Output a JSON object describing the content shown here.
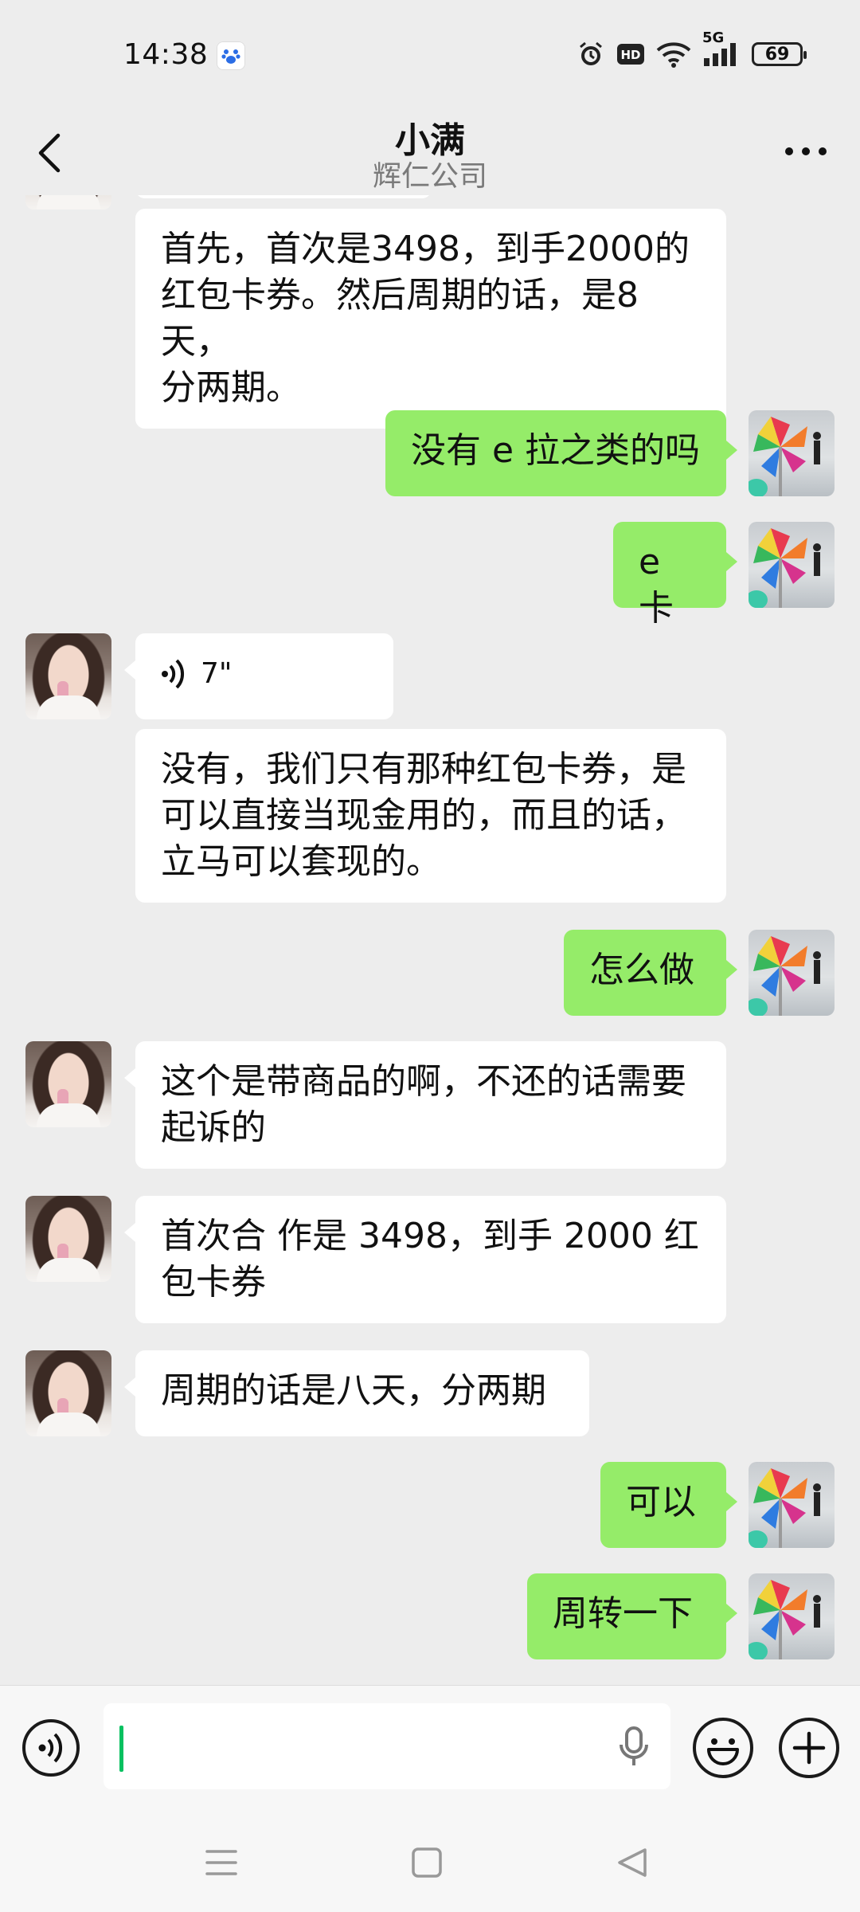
{
  "status_bar": {
    "time": "14:38",
    "battery": "69",
    "network": "5G",
    "icons": [
      "baidu-icon",
      "alarm-icon",
      "hd-icon",
      "wifi-icon",
      "signal-icon",
      "battery-icon"
    ]
  },
  "header": {
    "title": "小满",
    "subtitle": "辉仁公司"
  },
  "messages": [
    {
      "side": "left",
      "lines": [
        "首先，首次是3498，到手2000的",
        "红包卡券。然后周期的话，是8天，",
        "分两期。"
      ]
    },
    {
      "side": "right",
      "text": "没有 e 拉之类的吗"
    },
    {
      "side": "right",
      "text": "e 卡"
    },
    {
      "side": "left",
      "type": "voice",
      "duration": "7\""
    },
    {
      "side": "left",
      "lines": [
        "没有，我们只有那种红包卡券，是",
        "可以直接当现金用的，而且的话，",
        "立马可以套现的。"
      ]
    },
    {
      "side": "right",
      "text": "怎么做"
    },
    {
      "side": "left",
      "lines": [
        "这个是带商品的啊，不还的话需要",
        "起诉的"
      ]
    },
    {
      "side": "left",
      "lines": [
        "首次合 作是 3498，到手 2000 红",
        "包卡券"
      ]
    },
    {
      "side": "left",
      "text": "周期的话是八天，分两期"
    },
    {
      "side": "right",
      "text": "可以"
    },
    {
      "side": "right",
      "text": "周转一下"
    }
  ],
  "colors": {
    "background": "#ededed",
    "right_bubble": "#95ec69",
    "left_bubble": "#ffffff",
    "cursor": "#07c160"
  },
  "input_bar": {
    "value": "",
    "icons": [
      "voice-mode-icon",
      "microphone-icon",
      "emoji-icon",
      "plus-icon"
    ]
  },
  "nav_bar": {
    "icons": [
      "menu-icon",
      "home-icon",
      "back-triangle-icon"
    ]
  }
}
